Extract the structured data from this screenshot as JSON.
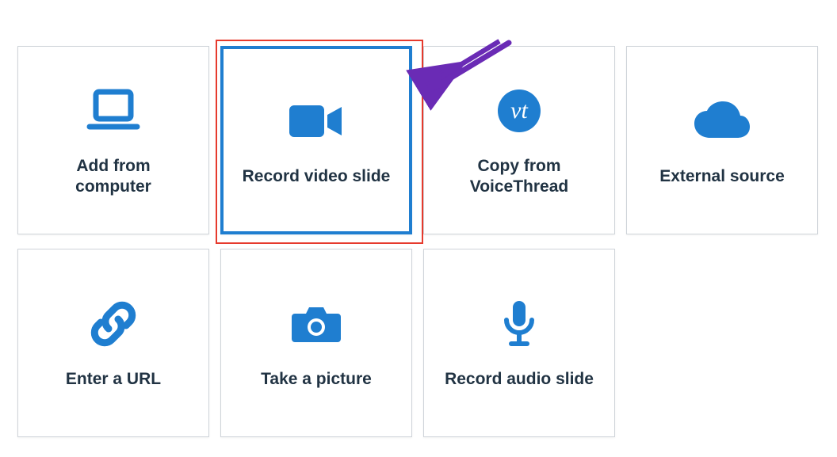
{
  "colors": {
    "icon": "#1f7ed0",
    "text": "#213343",
    "highlight_border": "#e63a2d",
    "arrow": "#6a2bb5"
  },
  "tiles": [
    {
      "id": "add-from-computer",
      "label": "Add from computer",
      "selected": false,
      "icon": "laptop-icon"
    },
    {
      "id": "record-video",
      "label": "Record video slide",
      "selected": true,
      "icon": "video-icon"
    },
    {
      "id": "copy-voicethread",
      "label": "Copy from VoiceThread",
      "selected": false,
      "icon": "vt-icon"
    },
    {
      "id": "external-source",
      "label": "External source",
      "selected": false,
      "icon": "cloud-icon"
    },
    {
      "id": "enter-url",
      "label": "Enter a URL",
      "selected": false,
      "icon": "link-icon"
    },
    {
      "id": "take-picture",
      "label": "Take a picture",
      "selected": false,
      "icon": "camera-icon"
    },
    {
      "id": "record-audio",
      "label": "Record audio slide",
      "selected": false,
      "icon": "microphone-icon"
    }
  ],
  "annotation": {
    "target": "record-video",
    "kind": "arrow-pointer"
  }
}
